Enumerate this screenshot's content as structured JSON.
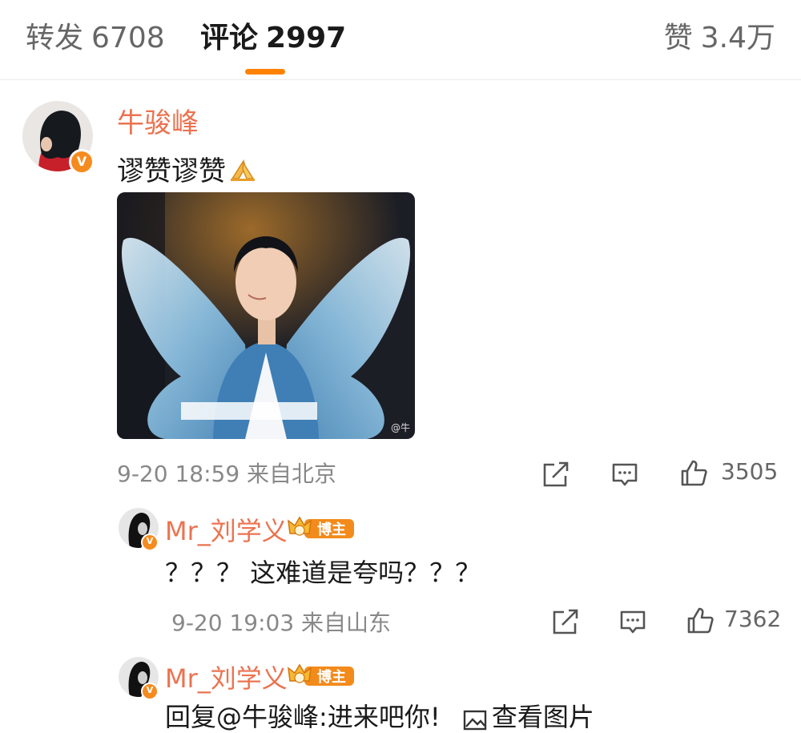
{
  "tabs": {
    "reposts": {
      "label": "转发",
      "count": "6708"
    },
    "comments": {
      "label": "评论",
      "count": "2997"
    },
    "likes": {
      "label": "赞",
      "count": "3.4万"
    }
  },
  "colors": {
    "accent": "#ff8200",
    "username": "#eb7350",
    "verified": "#f58b1f"
  },
  "main_comment": {
    "username": "牛骏峰",
    "verified_icon": "v-badge-icon",
    "text": "谬赞谬赞",
    "emoji": "pray-hands-icon",
    "image_watermark": "@牛",
    "time": "9-20 18:59",
    "location": "来自北京",
    "like_count": "3505"
  },
  "replies": [
    {
      "username": "Mr_刘学义",
      "badge": "博主",
      "text": "？？？ 这难道是夸吗？？？",
      "time": "9-20 19:03",
      "location": "来自山东",
      "like_count": "7362"
    },
    {
      "username": "Mr_刘学义",
      "badge": "博主",
      "reply_prefix": "回复",
      "mention": "@牛骏峰",
      "text": ":进来吧你!",
      "view_image_label": "查看图片"
    }
  ]
}
